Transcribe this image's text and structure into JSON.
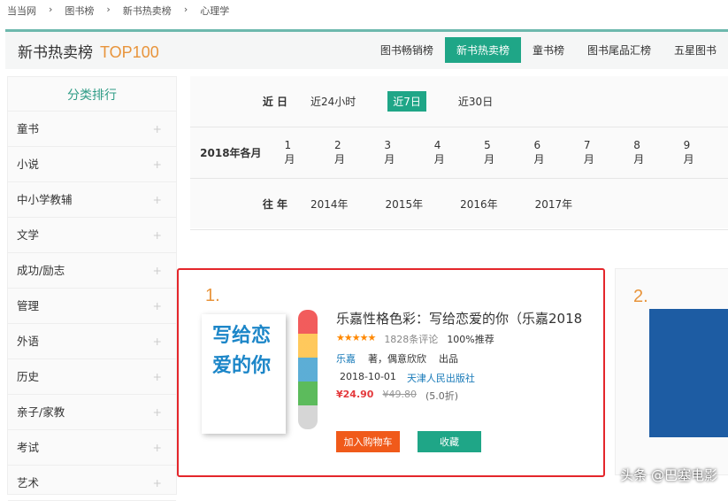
{
  "breadcrumb": [
    "当当网",
    "图书榜",
    "新书热卖榜",
    "心理学"
  ],
  "header": {
    "title": "新书热卖榜",
    "badge": "TOP100",
    "tabs": [
      "图书畅销榜",
      "新书热卖榜",
      "童书榜",
      "图书尾品汇榜",
      "五星图书"
    ]
  },
  "sidebar": {
    "title": "分类排行",
    "items": [
      "童书",
      "小说",
      "中小学教辅",
      "文学",
      "成功/励志",
      "管理",
      "外语",
      "历史",
      "亲子/家教",
      "考试",
      "艺术"
    ]
  },
  "filter": {
    "rows": [
      {
        "label": "近 日",
        "options": [
          "近24小时",
          "近7日",
          "近30日"
        ]
      },
      {
        "label": "2018年各月",
        "options": [
          "1月",
          "2月",
          "3月",
          "4月",
          "5月",
          "6月",
          "7月",
          "8月",
          "9月"
        ]
      },
      {
        "label": "往 年",
        "options": [
          "2014年",
          "2015年",
          "2016年",
          "2017年"
        ]
      }
    ]
  },
  "book1": {
    "rank": "1.",
    "title": "乐嘉性格色彩：写给恋爱的你（乐嘉2018",
    "stars": 5,
    "reviews": "1828条评论",
    "recommend": "100%推荐",
    "author": "乐嘉",
    "author_suffix": "著，偶意欣欣",
    "publisher_suffix": "出品",
    "date": "2018-10-01",
    "publisher": "天津人民出版社",
    "price": "¥24.90",
    "orig_price": "¥49.80",
    "discount": "(5.0折)",
    "cart": "加入购物车",
    "fav": "收藏",
    "cover_text": "写给恋爱的你"
  },
  "book2": {
    "rank": "2."
  },
  "watermark": "头条 @巴塞电影"
}
